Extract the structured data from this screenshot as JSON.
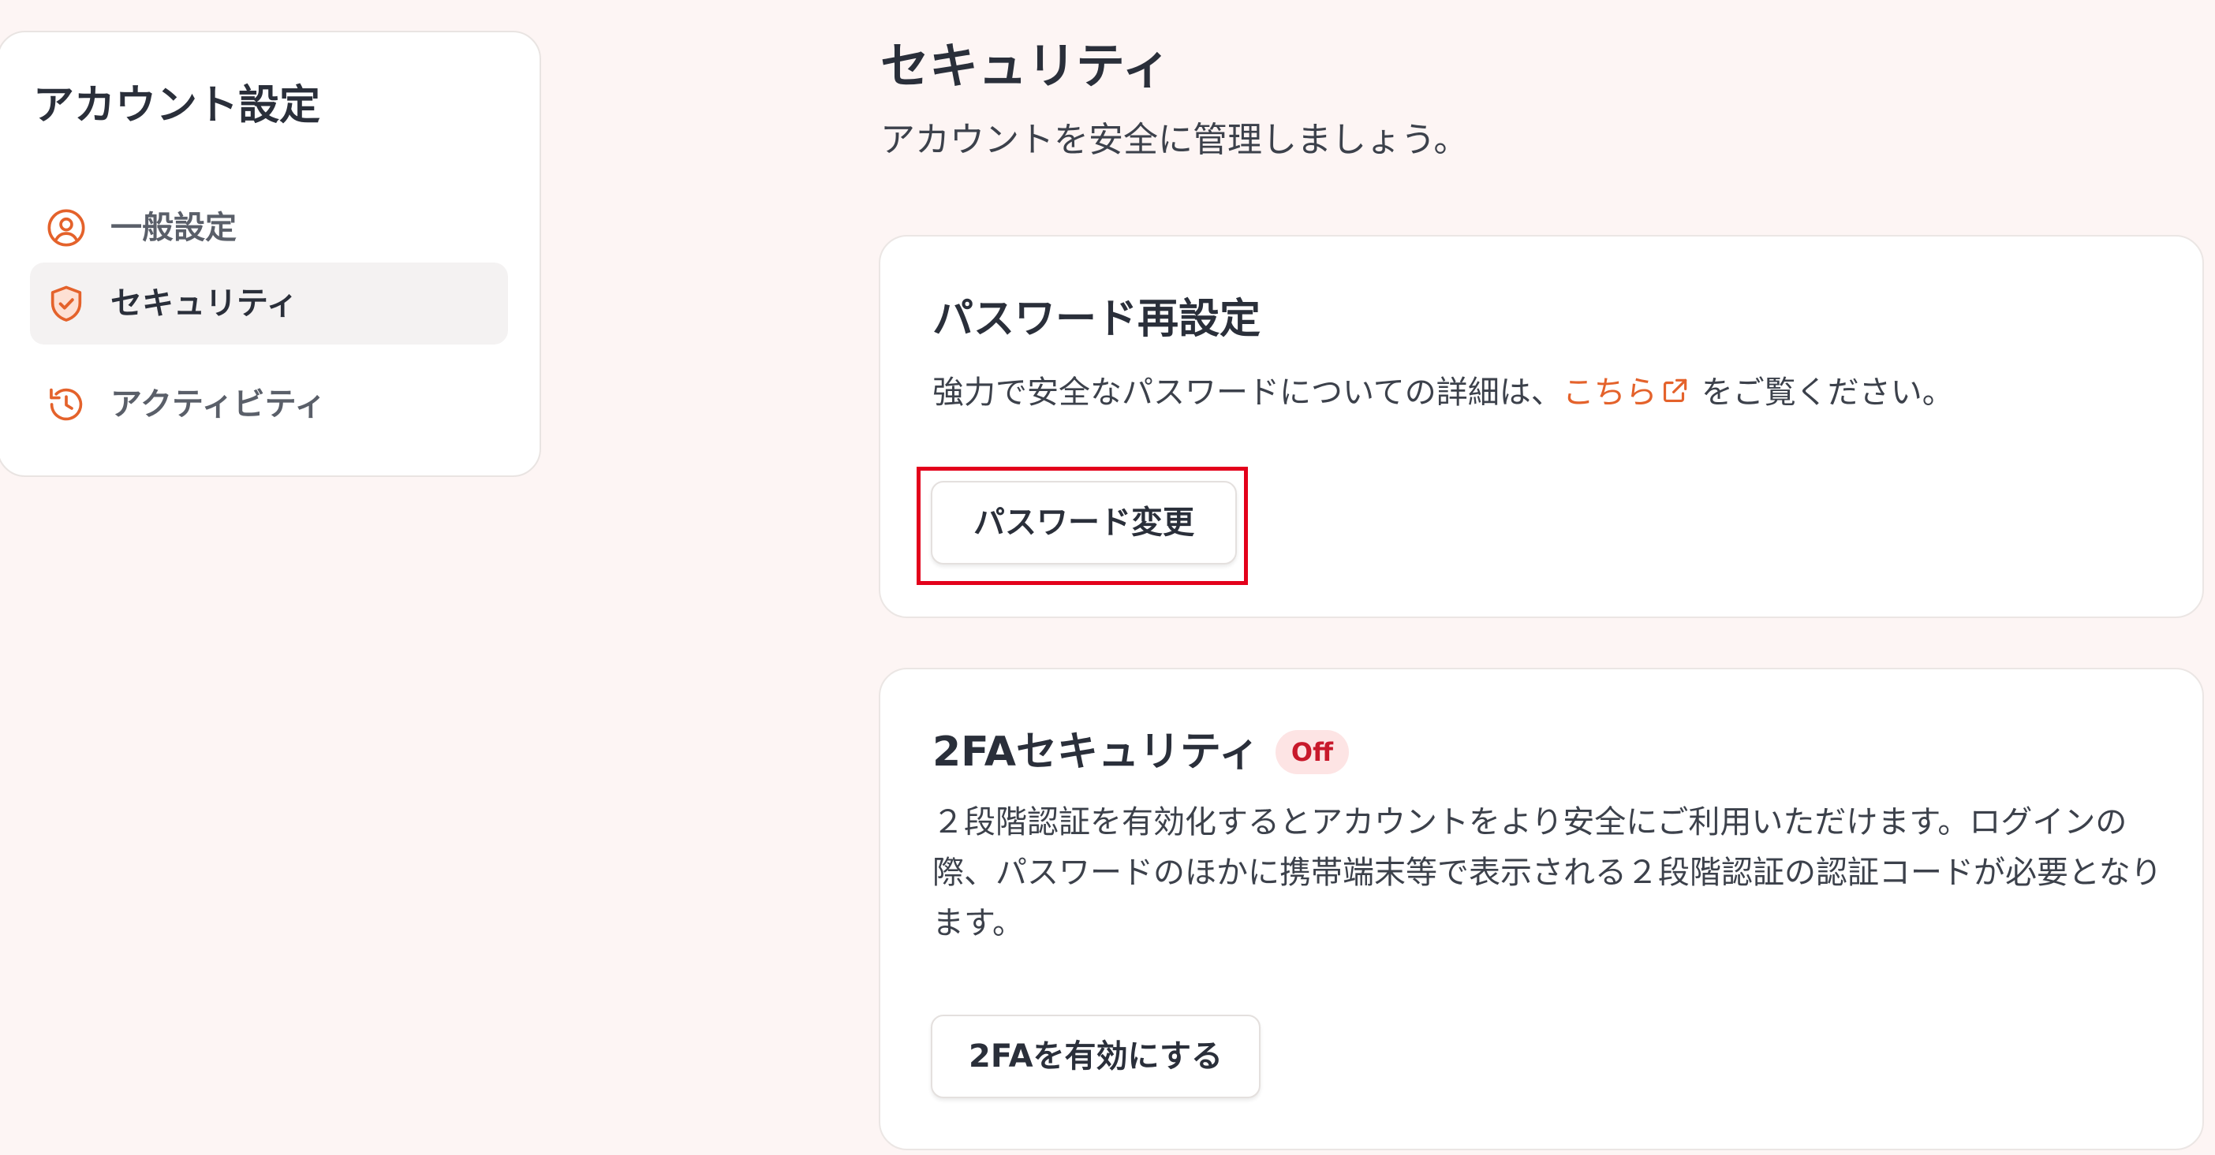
{
  "sidebar": {
    "title": "アカウント設定",
    "items": [
      {
        "label": "一般設定",
        "icon": "user-circle-icon",
        "active": false
      },
      {
        "label": "セキュリティ",
        "icon": "shield-check-icon",
        "active": true
      },
      {
        "label": "アクティビティ",
        "icon": "history-icon",
        "active": false
      }
    ]
  },
  "main": {
    "title": "セキュリティ",
    "subtitle": "アカウントを安全に管理しましょう。"
  },
  "password_card": {
    "title": "パスワード再設定",
    "text_before": "強力で安全なパスワードについての詳細は、",
    "link_text": "こちら",
    "text_after": "をご覧ください。",
    "button_label": "パスワード変更"
  },
  "twofa_card": {
    "title": "2FAセキュリティ",
    "status_badge": "Off",
    "description": "２段階認証を有効化するとアカウントをより安全にご利用いただけます。ログインの際、パスワードのほかに携帯端末等で表示される２段階認証の認証コードが必要となります。",
    "button_label": "2FAを有効にする"
  },
  "colors": {
    "accent": "#e4622b",
    "highlight": "#e3001b",
    "badge_bg": "#fde4e4",
    "badge_text": "#c8192b",
    "background": "#fdf5f4"
  }
}
